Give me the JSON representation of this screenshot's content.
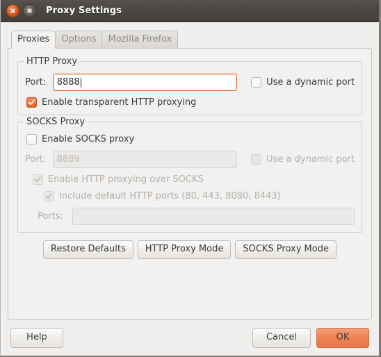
{
  "window": {
    "title": "Proxy Settings",
    "close_icon": "close-icon",
    "maximize_icon": "maximize-icon"
  },
  "tabs": [
    {
      "label": "Proxies",
      "active": true
    },
    {
      "label": "Options",
      "active": false
    },
    {
      "label": "Mozilla Firefox",
      "active": false
    }
  ],
  "http_proxy": {
    "legend": "HTTP Proxy",
    "port_label": "Port:",
    "port_value": "8888",
    "dynamic_port_label": "Use a dynamic port",
    "dynamic_port_checked": false,
    "transparent_label": "Enable transparent HTTP proxying",
    "transparent_checked": true
  },
  "socks_proxy": {
    "legend": "SOCKS Proxy",
    "enable_label": "Enable SOCKS proxy",
    "enable_checked": false,
    "port_label": "Port:",
    "port_value": "8889",
    "dynamic_port_label": "Use a dynamic port",
    "http_over_socks_label": "Enable HTTP proxying over SOCKS",
    "include_default_ports_label": "Include default HTTP ports (80, 443, 8080, 8443)",
    "ports_label": "Ports:",
    "ports_value": ""
  },
  "mode_buttons": {
    "restore_defaults": "Restore Defaults",
    "http_proxy_mode": "HTTP Proxy Mode",
    "socks_proxy_mode": "SOCKS Proxy Mode"
  },
  "footer": {
    "help": "Help",
    "cancel": "Cancel",
    "ok": "OK"
  },
  "colors": {
    "accent_orange": "#e4622a",
    "ok_button": "#ee8254",
    "titlebar": "#4a4742",
    "body_bg": "#f0efee"
  }
}
